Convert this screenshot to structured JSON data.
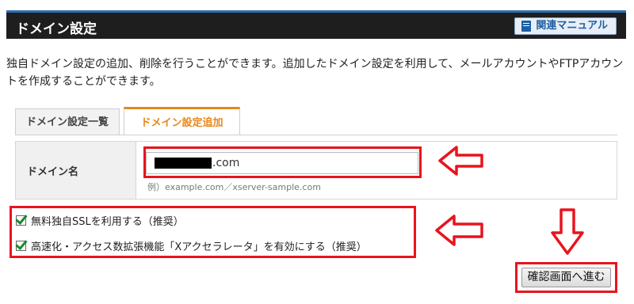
{
  "header": {
    "title": "ドメイン設定",
    "manual_button_label": "関連マニュアル"
  },
  "description": "独自ドメイン設定の追加、削除を行うことができます。追加したドメイン設定を利用して、メールアカウントやFTPアカウントを作成することができます。",
  "tabs": [
    {
      "label": "ドメイン設定一覧",
      "active": false
    },
    {
      "label": "ドメイン設定追加",
      "active": true
    }
  ],
  "form": {
    "domain_label": "ドメイン名",
    "domain_value_suffix": ".com",
    "domain_hint": "例）example.com／xserver-sample.com"
  },
  "options": [
    {
      "label": "無料独自SSLを利用する（推奨）",
      "checked": true
    },
    {
      "label": "高速化・アクセス数拡張機能「Xアクセラレータ」を有効にする（推奨）",
      "checked": true
    }
  ],
  "confirm_button_label": "確認画面へ進む",
  "colors": {
    "header_bg": "#1e1e1e",
    "header_accent": "#2f6fb6",
    "active_tab": "#e8871a",
    "annotation_red": "#e8141e",
    "check_green": "#1a8a2e"
  }
}
